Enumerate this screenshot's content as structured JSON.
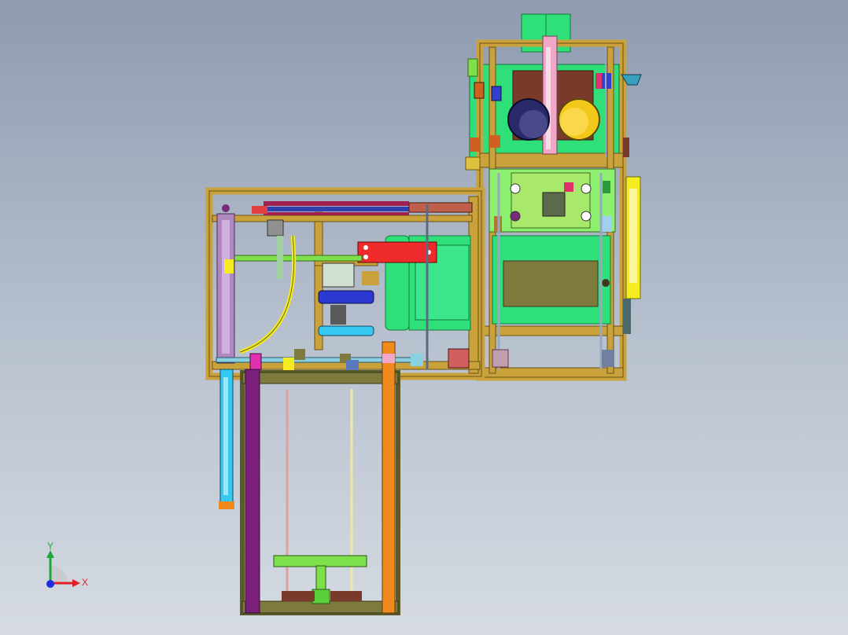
{
  "viewport": {
    "background_top": "#8e9bb0",
    "background_bottom": "#d6dbe2"
  },
  "triad": {
    "x_label": "X",
    "y_label": "Y",
    "x_color": "#e0202a",
    "y_color": "#1fa83a",
    "origin_color": "#1d2ce0"
  },
  "colors": {
    "frame": "#c9a23c",
    "frame_dark": "#7a5e16",
    "green_panel": "#2fe07a",
    "olive": "#7e7a3e",
    "red_block": "#ee2a2a",
    "orange": "#f08a1c",
    "purple": "#7a1f7a",
    "cyan": "#35c8f0",
    "yellow_pipe": "#f4ec20",
    "brown": "#7a3a2a",
    "pink": "#f0a8c8",
    "navy_cylinder": "#2a2a6a",
    "yellow_cylinder": "#f4c81a",
    "light_green": "#8ef070"
  }
}
